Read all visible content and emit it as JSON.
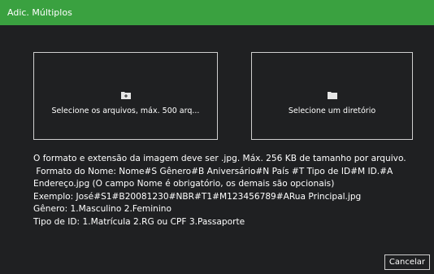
{
  "dialog": {
    "title": "Adic. Múltiplos"
  },
  "select_files": {
    "icon": "add-folder-icon",
    "label": "Selecione os arquivos, máx. 500 arq..."
  },
  "select_directory": {
    "icon": "folder-icon",
    "label": "Selecione um diretório"
  },
  "info": {
    "lines": [
      "O formato e extensão da imagem deve ser .jpg. Máx. 256 KB de tamanho por arquivo.",
      " Formato do Nome: Nome#S Gênero#B Aniversário#N País #T Tipo de ID#M ID.#A",
      "Endereço.jpg (O campo Nome é obrigatório, os demais são opcionais)",
      "Exemplo: José#S1#B20081230#NBR#T1#M123456789#ARua Principal.jpg",
      "Gênero: 1.Masculino 2.Feminino",
      "Tipo de ID: 1.Matrícula 2.RG ou CPF 3.Passaporte"
    ]
  },
  "buttons": {
    "cancel": "Cancelar"
  },
  "colors": {
    "title_bar": "#3aa140",
    "background": "#1f2022",
    "text": "#ffffff",
    "border": "#cfcfcf"
  }
}
